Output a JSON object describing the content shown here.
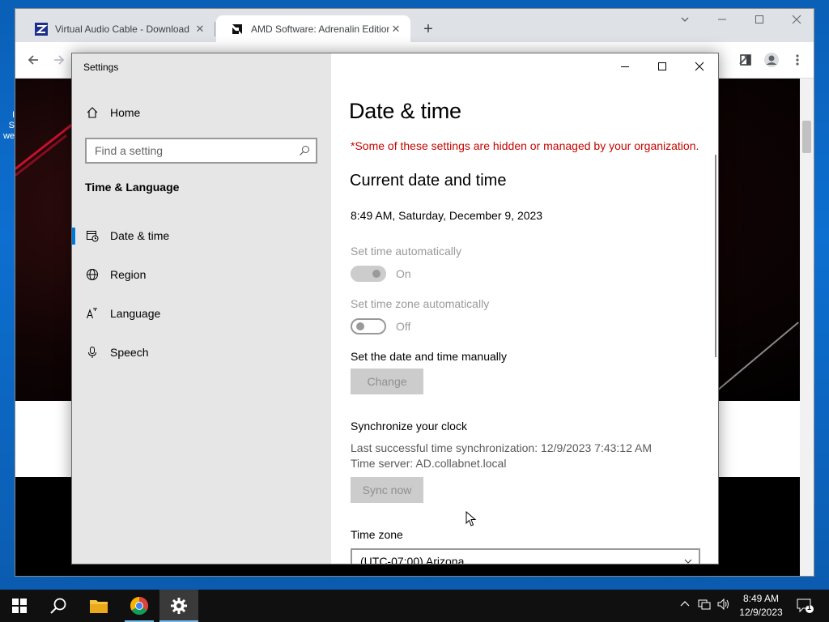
{
  "desktop": {
    "fragment": "I\nS\nwe"
  },
  "browser": {
    "tabs": [
      {
        "title": "Virtual Audio Cable - Download",
        "active": false
      },
      {
        "title": "AMD Software: Adrenalin Edition",
        "active": true
      }
    ]
  },
  "settings": {
    "window_title": "Settings",
    "nav": {
      "home": "Home",
      "search_placeholder": "Find a setting",
      "section": "Time & Language",
      "items": [
        {
          "label": "Date & time",
          "selected": true
        },
        {
          "label": "Region",
          "selected": false
        },
        {
          "label": "Language",
          "selected": false
        },
        {
          "label": "Speech",
          "selected": false
        }
      ]
    },
    "content": {
      "title": "Date & time",
      "managed_notice": "*Some of these settings are hidden or managed by your organization.",
      "subheading": "Current date and time",
      "current_datetime": "8:49 AM, Saturday, December 9, 2023",
      "set_time_auto": {
        "label": "Set time automatically",
        "state": "On"
      },
      "set_tz_auto": {
        "label": "Set time zone automatically",
        "state": "Off"
      },
      "manual_label": "Set the date and time manually",
      "change_button": "Change",
      "sync_heading": "Synchronize your clock",
      "last_sync": "Last successful time synchronization: 12/9/2023 7:43:12 AM",
      "time_server": "Time server: AD.collabnet.local",
      "sync_button": "Sync now",
      "timezone_label": "Time zone",
      "timezone_value": "(UTC-07:00) Arizona"
    }
  },
  "taskbar": {
    "clock_time": "8:49 AM",
    "clock_date": "12/9/2023",
    "notification_count": "1"
  },
  "colors": {
    "accent": "#0078d7",
    "managed_text": "#c50500",
    "taskbar": "#101010"
  }
}
